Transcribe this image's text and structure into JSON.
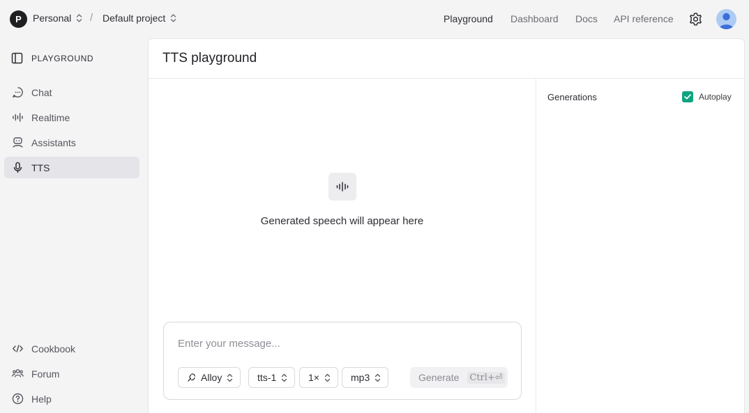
{
  "topbar": {
    "org_initial": "P",
    "org_name": "Personal",
    "separator": "/",
    "project_name": "Default project",
    "nav": [
      "Playground",
      "Dashboard",
      "Docs",
      "API reference"
    ],
    "active_nav": "Playground",
    "settings_icon": "gear-icon",
    "user_icon": "user-avatar-icon"
  },
  "sidebar": {
    "header": "PLAYGROUND",
    "items": [
      {
        "label": "Chat",
        "icon": "chat-bubble-icon"
      },
      {
        "label": "Realtime",
        "icon": "waveform-icon"
      },
      {
        "label": "Assistants",
        "icon": "robot-icon"
      },
      {
        "label": "TTS",
        "icon": "microphone-icon",
        "active": true
      }
    ],
    "footer": [
      {
        "label": "Cookbook",
        "icon": "code-icon"
      },
      {
        "label": "Forum",
        "icon": "people-icon"
      },
      {
        "label": "Help",
        "icon": "question-circle-icon"
      }
    ]
  },
  "main": {
    "title": "TTS playground",
    "empty_state": "Generated speech will appear here",
    "generations_title": "Generations",
    "autoplay_label": "Autoplay",
    "autoplay_checked": true,
    "composer": {
      "placeholder": "Enter your message...",
      "voice": "Alloy",
      "model": "tts-1",
      "speed": "1×",
      "format": "mp3",
      "generate_label": "Generate",
      "shortcut": "Ctrl+⏎"
    }
  },
  "colors": {
    "accent_green": "#10a37f",
    "active_item_bg": "#e4e4e9",
    "page_bg": "#f4f4f5"
  }
}
